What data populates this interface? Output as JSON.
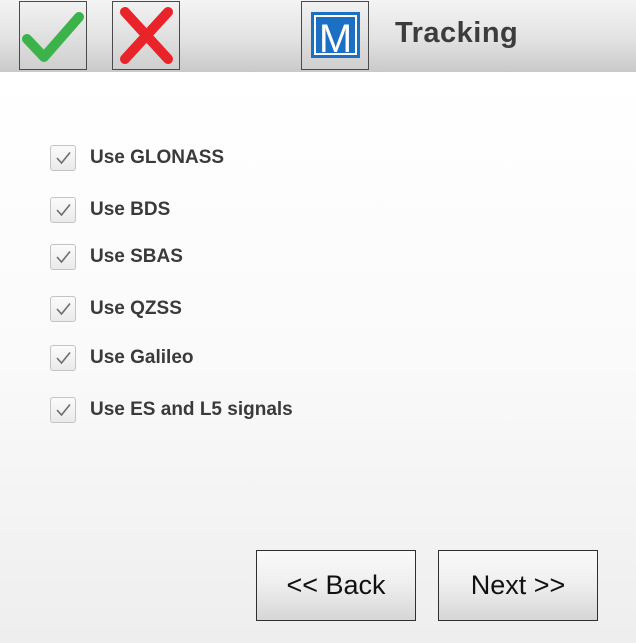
{
  "header": {
    "title": "Tracking",
    "accept_icon": "checkmark-icon",
    "cancel_icon": "x-icon",
    "logo_icon": "m-logo-icon",
    "logo_letter": "M"
  },
  "colors": {
    "accept_green": "#3cb34a",
    "cancel_red": "#e8242a",
    "logo_blue": "#1b6fc4"
  },
  "options": [
    {
      "label": "Use GLONASS",
      "checked": true
    },
    {
      "label": "Use BDS",
      "checked": true
    },
    {
      "label": "Use SBAS",
      "checked": true
    },
    {
      "label": "Use QZSS",
      "checked": true
    },
    {
      "label": "Use Galileo",
      "checked": true
    },
    {
      "label": "Use ES and L5 signals",
      "checked": true
    }
  ],
  "nav": {
    "back_label": "<< Back",
    "next_label": "Next >>"
  }
}
